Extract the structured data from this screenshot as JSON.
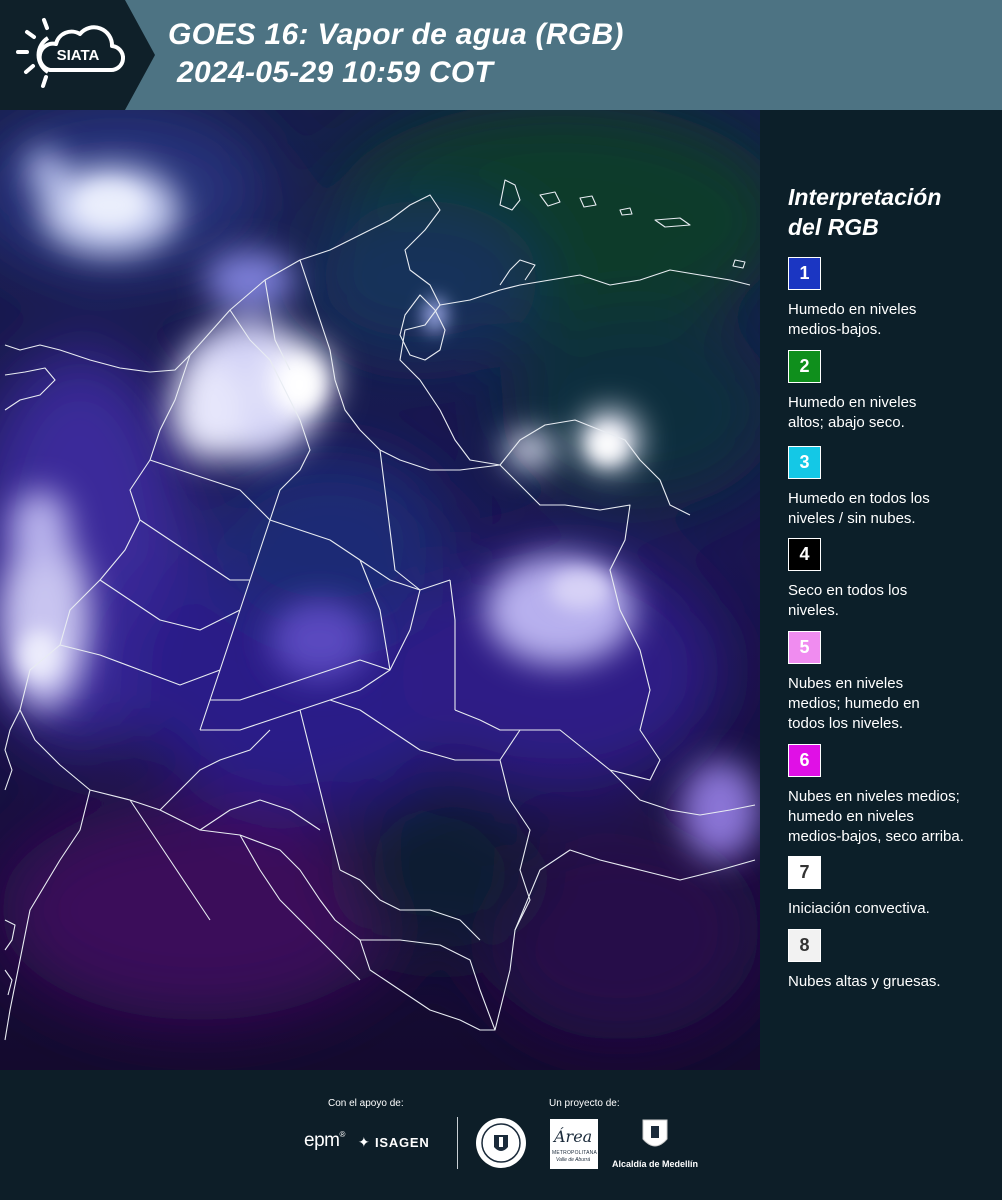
{
  "header": {
    "logo_text": "SIATA",
    "title_line1": "GOES 16: Vapor de agua (RGB)",
    "title_line2": "2024-05-29 10:59 COT",
    "background": "#4d7383"
  },
  "legend": {
    "title_line1": "Interpretación",
    "title_line2": "del RGB",
    "items": [
      {
        "number": "1",
        "color": "#1b36c2",
        "text_color": "#ffffff",
        "lines": [
          "Humedo en niveles",
          "medios-bajos."
        ]
      },
      {
        "number": "2",
        "color": "#0f8f1c",
        "text_color": "#ffffff",
        "lines": [
          "Humedo en niveles",
          "altos; abajo seco."
        ]
      },
      {
        "number": "3",
        "color": "#14c8e6",
        "text_color": "#ffffff",
        "lines": [
          "Humedo en todos los",
          "niveles / sin nubes."
        ]
      },
      {
        "number": "4",
        "color": "#000000",
        "text_color": "#ffffff",
        "lines": [
          "Seco en todos los",
          "niveles."
        ]
      },
      {
        "number": "5",
        "color": "#f08cf0",
        "text_color": "#ffffff",
        "lines": [
          "Nubes en niveles",
          "medios; humedo en",
          "todos los niveles."
        ]
      },
      {
        "number": "6",
        "color": "#e010e6",
        "text_color": "#ffffff",
        "lines": [
          "Nubes en niveles medios;",
          "humedo en niveles",
          "medios-bajos, seco arriba."
        ]
      },
      {
        "number": "7",
        "color": "#ffffff",
        "text_color": "#333333",
        "lines": [
          "Iniciación convectiva."
        ]
      },
      {
        "number": "8",
        "color": "#f2f2f2",
        "text_color": "#333333",
        "lines": [
          "Nubes altas y gruesas."
        ]
      }
    ]
  },
  "footer": {
    "support_label": "Con el apoyo de:",
    "project_label": "Un proyecto de:",
    "sponsor_epm": "epm",
    "sponsor_isagen": "ISAGEN",
    "area_logo_text": "Área",
    "area_sub1": "METROPOLITANA",
    "area_sub2": "Valle de Aburrá",
    "alcaldia": "Alcaldía de Medellín"
  }
}
